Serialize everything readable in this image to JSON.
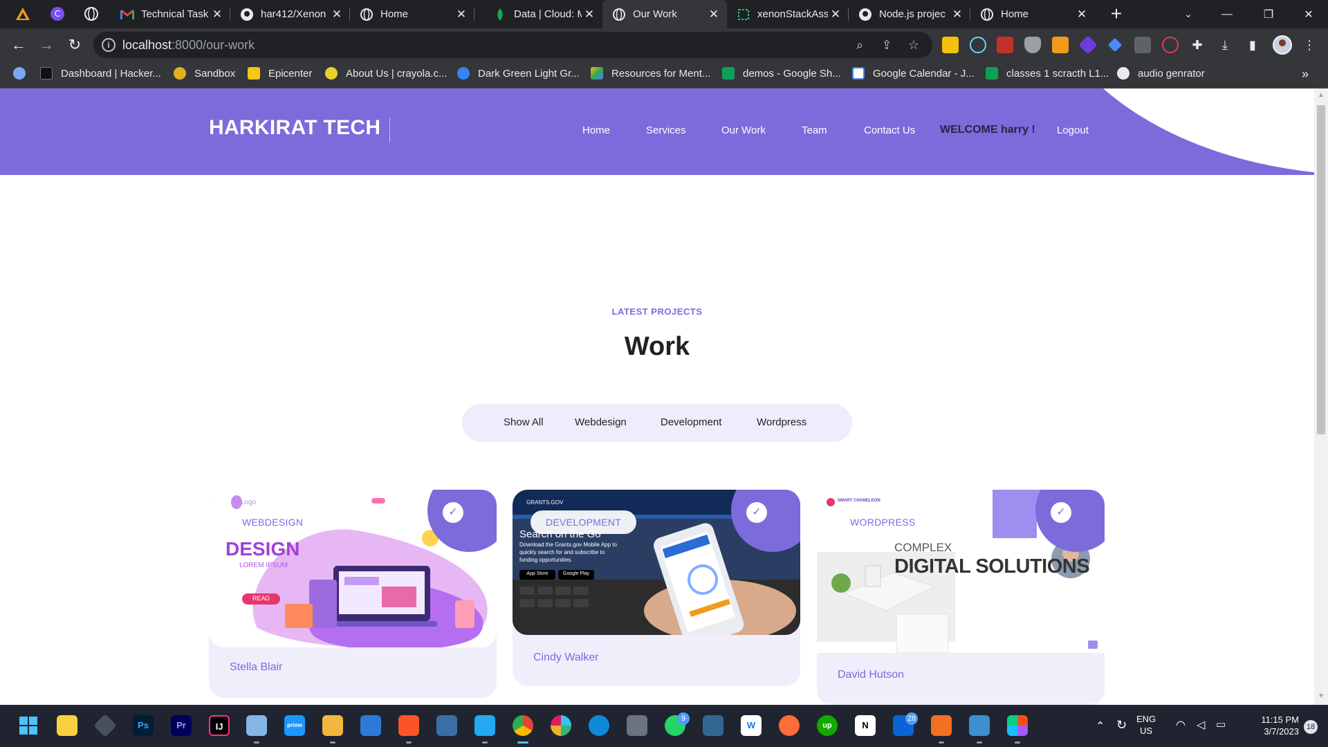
{
  "browser": {
    "tabs": [
      {
        "title": "Technical Task |",
        "icon": "gmail-icon",
        "active": false
      },
      {
        "title": "har412/Xenon",
        "icon": "github-icon",
        "active": false
      },
      {
        "title": "Home",
        "icon": "globe-icon",
        "active": false
      },
      {
        "title": "Data | Cloud: M",
        "icon": "mongodb-icon",
        "active": false
      },
      {
        "title": "Our Work",
        "icon": "globe-icon",
        "active": true
      },
      {
        "title": "xenonStackAss",
        "icon": "replit-icon",
        "active": false
      },
      {
        "title": "Node.js projec",
        "icon": "github-icon",
        "active": false
      },
      {
        "title": "Home",
        "icon": "globe-icon",
        "active": false
      }
    ],
    "url_host": "localhost",
    "url_path": ":8000/our-work",
    "bookmarks": [
      {
        "label": "Dashboard | Hacker...",
        "color": "#111111"
      },
      {
        "label": "Sandbox",
        "color": "#e0b020"
      },
      {
        "label": "Epicenter",
        "color": "#f5c518"
      },
      {
        "label": "About Us | crayola.c...",
        "color": "#e9d32b"
      },
      {
        "label": "Dark Green Light Gr...",
        "color": "#3b82f6"
      },
      {
        "label": "Resources for Ment...",
        "color": "#34a853"
      },
      {
        "label": "demos - Google Sh...",
        "color": "#0f9d58"
      },
      {
        "label": "Google Calendar - J...",
        "color": "#4285f4"
      },
      {
        "label": "classes 1 scracth L1...",
        "color": "#0f9d58"
      },
      {
        "label": "audio genrator",
        "color": "#e8eaed"
      }
    ],
    "bookmarks_more": "»"
  },
  "site": {
    "brand": "HARKIRAT TECH",
    "nav": [
      "Home",
      "Services",
      "Our Work",
      "Team",
      "Contact Us"
    ],
    "welcome": "WELCOME harry !",
    "logout": "Logout",
    "accent_color": "#7c6bdb"
  },
  "section": {
    "eyebrow": "LATEST PROJECTS",
    "title": "Work",
    "filters": [
      "Show All",
      "Webdesign",
      "Development",
      "Wordpress"
    ]
  },
  "projects": [
    {
      "category": "WEBDESIGN",
      "author": "Stella Blair",
      "image": {
        "logo": "Logo",
        "heading": "DESIGN",
        "sub": "LOREM IPSUM",
        "btn": "READ"
      }
    },
    {
      "category": "DEVELOPMENT",
      "author": "Cindy Walker",
      "image": {
        "logo": "GRANTS.GOV",
        "heading": "Search on the Go",
        "sub": "Download the Grants.gov Mobile App to quickly search for and subscribe to funding opportunities.",
        "btn1": "App Store",
        "btn2": "Google Play"
      }
    },
    {
      "category": "WORDPRESS",
      "author": "David Hutson",
      "image": {
        "logo": "SMART CHAMELEON",
        "line1": "COMPLEX",
        "line2": "DIGITAL SOLUTIONS"
      }
    }
  ],
  "taskbar": {
    "lang1": "ENG",
    "lang2": "US",
    "time": "11:15 PM",
    "date": "3/7/2023",
    "notif_count": "18",
    "whatsapp_badge": "9",
    "mail_badge": "28"
  }
}
